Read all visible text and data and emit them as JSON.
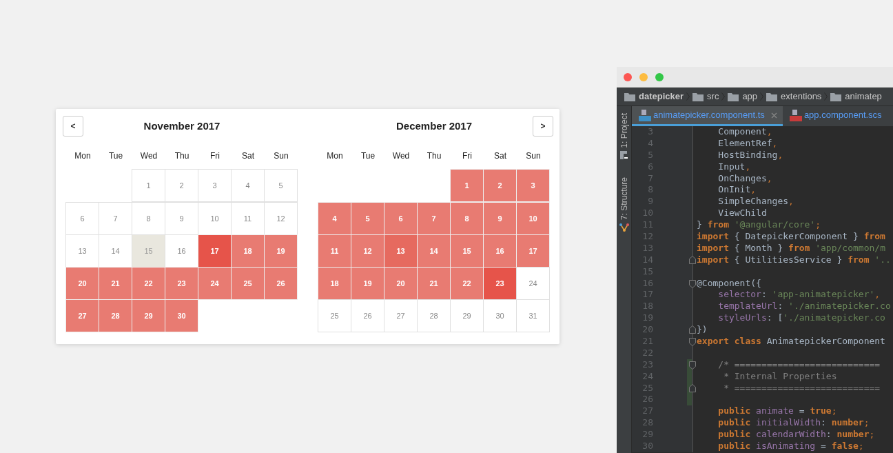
{
  "datepicker": {
    "prev_button": {
      "label": "<"
    },
    "next_button": {
      "label": ">"
    },
    "months": [
      {
        "title": "November 2017",
        "weekdays": [
          "Mon",
          "Tue",
          "Wed",
          "Thu",
          "Fri",
          "Sat",
          "Sun"
        ],
        "weeks": [
          [
            {
              "kind": "blank"
            },
            {
              "kind": "blank"
            },
            {
              "label": "1",
              "kind": "plain"
            },
            {
              "label": "2",
              "kind": "plain"
            },
            {
              "label": "3",
              "kind": "plain"
            },
            {
              "label": "4",
              "kind": "plain"
            },
            {
              "label": "5",
              "kind": "plain"
            }
          ],
          [
            {
              "label": "6",
              "kind": "plain"
            },
            {
              "label": "7",
              "kind": "plain"
            },
            {
              "label": "8",
              "kind": "plain"
            },
            {
              "label": "9",
              "kind": "plain"
            },
            {
              "label": "10",
              "kind": "plain"
            },
            {
              "label": "11",
              "kind": "plain"
            },
            {
              "label": "12",
              "kind": "plain"
            }
          ],
          [
            {
              "label": "13",
              "kind": "plain"
            },
            {
              "label": "14",
              "kind": "plain"
            },
            {
              "label": "15",
              "kind": "today"
            },
            {
              "label": "16",
              "kind": "plain"
            },
            {
              "label": "17",
              "kind": "endpoint"
            },
            {
              "label": "18",
              "kind": "range"
            },
            {
              "label": "19",
              "kind": "range"
            }
          ],
          [
            {
              "label": "20",
              "kind": "range"
            },
            {
              "label": "21",
              "kind": "range"
            },
            {
              "label": "22",
              "kind": "range"
            },
            {
              "label": "23",
              "kind": "range"
            },
            {
              "label": "24",
              "kind": "range"
            },
            {
              "label": "25",
              "kind": "range"
            },
            {
              "label": "26",
              "kind": "range"
            }
          ],
          [
            {
              "label": "27",
              "kind": "range"
            },
            {
              "label": "28",
              "kind": "range"
            },
            {
              "label": "29",
              "kind": "range"
            },
            {
              "label": "30",
              "kind": "range"
            },
            {
              "kind": "blank"
            },
            {
              "kind": "blank"
            },
            {
              "kind": "blank"
            }
          ]
        ]
      },
      {
        "title": "December 2017",
        "weekdays": [
          "Mon",
          "Tue",
          "Wed",
          "Thu",
          "Fri",
          "Sat",
          "Sun"
        ],
        "weeks": [
          [
            {
              "kind": "blank"
            },
            {
              "kind": "blank"
            },
            {
              "kind": "blank"
            },
            {
              "kind": "blank"
            },
            {
              "label": "1",
              "kind": "range"
            },
            {
              "label": "2",
              "kind": "range"
            },
            {
              "label": "3",
              "kind": "range"
            }
          ],
          [
            {
              "label": "4",
              "kind": "range"
            },
            {
              "label": "5",
              "kind": "range"
            },
            {
              "label": "6",
              "kind": "range"
            },
            {
              "label": "7",
              "kind": "range"
            },
            {
              "label": "8",
              "kind": "range"
            },
            {
              "label": "9",
              "kind": "range"
            },
            {
              "label": "10",
              "kind": "range"
            }
          ],
          [
            {
              "label": "11",
              "kind": "range"
            },
            {
              "label": "12",
              "kind": "range"
            },
            {
              "label": "13",
              "kind": "hover"
            },
            {
              "label": "14",
              "kind": "range"
            },
            {
              "label": "15",
              "kind": "range"
            },
            {
              "label": "16",
              "kind": "range"
            },
            {
              "label": "17",
              "kind": "range"
            }
          ],
          [
            {
              "label": "18",
              "kind": "range"
            },
            {
              "label": "19",
              "kind": "range"
            },
            {
              "label": "20",
              "kind": "range"
            },
            {
              "label": "21",
              "kind": "range"
            },
            {
              "label": "22",
              "kind": "range"
            },
            {
              "label": "23",
              "kind": "endpoint"
            },
            {
              "label": "24",
              "kind": "plain"
            }
          ],
          [
            {
              "label": "25",
              "kind": "plain"
            },
            {
              "label": "26",
              "kind": "plain"
            },
            {
              "label": "27",
              "kind": "plain"
            },
            {
              "label": "28",
              "kind": "plain"
            },
            {
              "label": "29",
              "kind": "plain"
            },
            {
              "label": "30",
              "kind": "plain"
            },
            {
              "label": "31",
              "kind": "plain"
            }
          ]
        ]
      }
    ]
  },
  "ide": {
    "breadcrumbs": [
      {
        "label": "datepicker",
        "bold": true
      },
      {
        "label": "src",
        "bold": false
      },
      {
        "label": "app",
        "bold": false
      },
      {
        "label": "extentions",
        "bold": false
      },
      {
        "label": "animatep",
        "bold": false
      }
    ],
    "tool_windows": [
      {
        "label": "1: Project",
        "kind": "project"
      },
      {
        "label": "7: Structure",
        "kind": "structure"
      }
    ],
    "tabs": [
      {
        "label": "animatepicker.component.ts",
        "kind": "ts",
        "selected": true
      },
      {
        "label": "app.component.scs",
        "kind": "scss",
        "selected": false
      }
    ],
    "lines": [
      {
        "n": "3",
        "tokens": [
          {
            "text": "    Component",
            "kind": "plain"
          },
          {
            "text": ",",
            "kind": "punct"
          }
        ]
      },
      {
        "n": "4",
        "tokens": [
          {
            "text": "    ElementRef",
            "kind": "plain"
          },
          {
            "text": ",",
            "kind": "punct"
          }
        ]
      },
      {
        "n": "5",
        "tokens": [
          {
            "text": "    HostBinding",
            "kind": "plain"
          },
          {
            "text": ",",
            "kind": "punct"
          }
        ]
      },
      {
        "n": "6",
        "tokens": [
          {
            "text": "    Input",
            "kind": "plain"
          },
          {
            "text": ",",
            "kind": "punct"
          }
        ]
      },
      {
        "n": "7",
        "tokens": [
          {
            "text": "    OnChanges",
            "kind": "plain"
          },
          {
            "text": ",",
            "kind": "punct"
          }
        ]
      },
      {
        "n": "8",
        "tokens": [
          {
            "text": "    OnInit",
            "kind": "plain"
          },
          {
            "text": ",",
            "kind": "punct"
          }
        ]
      },
      {
        "n": "9",
        "tokens": [
          {
            "text": "    SimpleChanges",
            "kind": "plain"
          },
          {
            "text": ",",
            "kind": "punct"
          }
        ]
      },
      {
        "n": "10",
        "tokens": [
          {
            "text": "    ViewChild",
            "kind": "plain"
          }
        ]
      },
      {
        "n": "11",
        "tokens": [
          {
            "text": "} ",
            "kind": "plain"
          },
          {
            "text": "from ",
            "kind": "keyword"
          },
          {
            "text": "'@angular/core'",
            "kind": "string"
          },
          {
            "text": ";",
            "kind": "punct"
          }
        ]
      },
      {
        "n": "12",
        "tokens": [
          {
            "text": "import ",
            "kind": "keyword"
          },
          {
            "text": "{ DatepickerComponent } ",
            "kind": "plain"
          },
          {
            "text": "from",
            "kind": "keyword"
          }
        ]
      },
      {
        "n": "13",
        "tokens": [
          {
            "text": "import ",
            "kind": "keyword"
          },
          {
            "text": "{ Month } ",
            "kind": "plain"
          },
          {
            "text": "from ",
            "kind": "keyword"
          },
          {
            "text": "'app/common/m",
            "kind": "string"
          }
        ]
      },
      {
        "n": "14",
        "fold_end": true,
        "tokens": [
          {
            "text": "import ",
            "kind": "keyword"
          },
          {
            "text": "{ UtilitiesService } ",
            "kind": "plain"
          },
          {
            "text": "from ",
            "kind": "keyword"
          },
          {
            "text": "'..",
            "kind": "string"
          }
        ]
      },
      {
        "n": "15"
      },
      {
        "n": "16",
        "fold_start": true,
        "tokens": [
          {
            "text": "@Component({",
            "kind": "plain"
          }
        ]
      },
      {
        "n": "17",
        "tokens": [
          {
            "text": "    selector",
            "kind": "field"
          },
          {
            "text": ": ",
            "kind": "plain"
          },
          {
            "text": "'app-animatepicker'",
            "kind": "string"
          },
          {
            "text": ",",
            "kind": "punct"
          }
        ]
      },
      {
        "n": "18",
        "tokens": [
          {
            "text": "    templateUrl",
            "kind": "field"
          },
          {
            "text": ": ",
            "kind": "plain"
          },
          {
            "text": "'./animatepicker.co",
            "kind": "string"
          }
        ]
      },
      {
        "n": "19",
        "tokens": [
          {
            "text": "    styleUrls",
            "kind": "field"
          },
          {
            "text": ": [",
            "kind": "plain"
          },
          {
            "text": "'./animatepicker.co",
            "kind": "string"
          }
        ]
      },
      {
        "n": "20",
        "fold_end": true,
        "tokens": [
          {
            "text": "})",
            "kind": "plain"
          }
        ]
      },
      {
        "n": "21",
        "fold_start": true,
        "tokens": [
          {
            "text": "export class ",
            "kind": "keyword"
          },
          {
            "text": "AnimatepickerComponent",
            "kind": "plain"
          }
        ]
      },
      {
        "n": "22"
      },
      {
        "n": "23",
        "fold_start": true,
        "changed": true,
        "tokens": [
          {
            "text": "    /* ===========================",
            "kind": "comment"
          }
        ]
      },
      {
        "n": "24",
        "changed": true,
        "tokens": [
          {
            "text": "     * Internal Properties",
            "kind": "comment"
          }
        ]
      },
      {
        "n": "25",
        "fold_end": true,
        "changed": true,
        "tokens": [
          {
            "text": "     * ===========================",
            "kind": "comment"
          }
        ]
      },
      {
        "n": "26",
        "changed": true
      },
      {
        "n": "27",
        "tokens": [
          {
            "text": "    public ",
            "kind": "keyword"
          },
          {
            "text": "animate",
            "kind": "field"
          },
          {
            "text": " = ",
            "kind": "plain"
          },
          {
            "text": "true",
            "kind": "keyword"
          },
          {
            "text": ";",
            "kind": "punct"
          }
        ]
      },
      {
        "n": "28",
        "tokens": [
          {
            "text": "    public ",
            "kind": "keyword"
          },
          {
            "text": "initialWidth",
            "kind": "field"
          },
          {
            "text": ": ",
            "kind": "plain"
          },
          {
            "text": "number",
            "kind": "keyword"
          },
          {
            "text": ";",
            "kind": "punct"
          }
        ]
      },
      {
        "n": "29",
        "tokens": [
          {
            "text": "    public ",
            "kind": "keyword"
          },
          {
            "text": "calendarWidth",
            "kind": "field"
          },
          {
            "text": ": ",
            "kind": "plain"
          },
          {
            "text": "number",
            "kind": "keyword"
          },
          {
            "text": ";",
            "kind": "punct"
          }
        ]
      },
      {
        "n": "30",
        "tokens": [
          {
            "text": "    public ",
            "kind": "keyword"
          },
          {
            "text": "isAnimating",
            "kind": "field"
          },
          {
            "text": " = ",
            "kind": "plain"
          },
          {
            "text": "false",
            "kind": "keyword"
          },
          {
            "text": ";",
            "kind": "punct"
          }
        ]
      }
    ]
  }
}
